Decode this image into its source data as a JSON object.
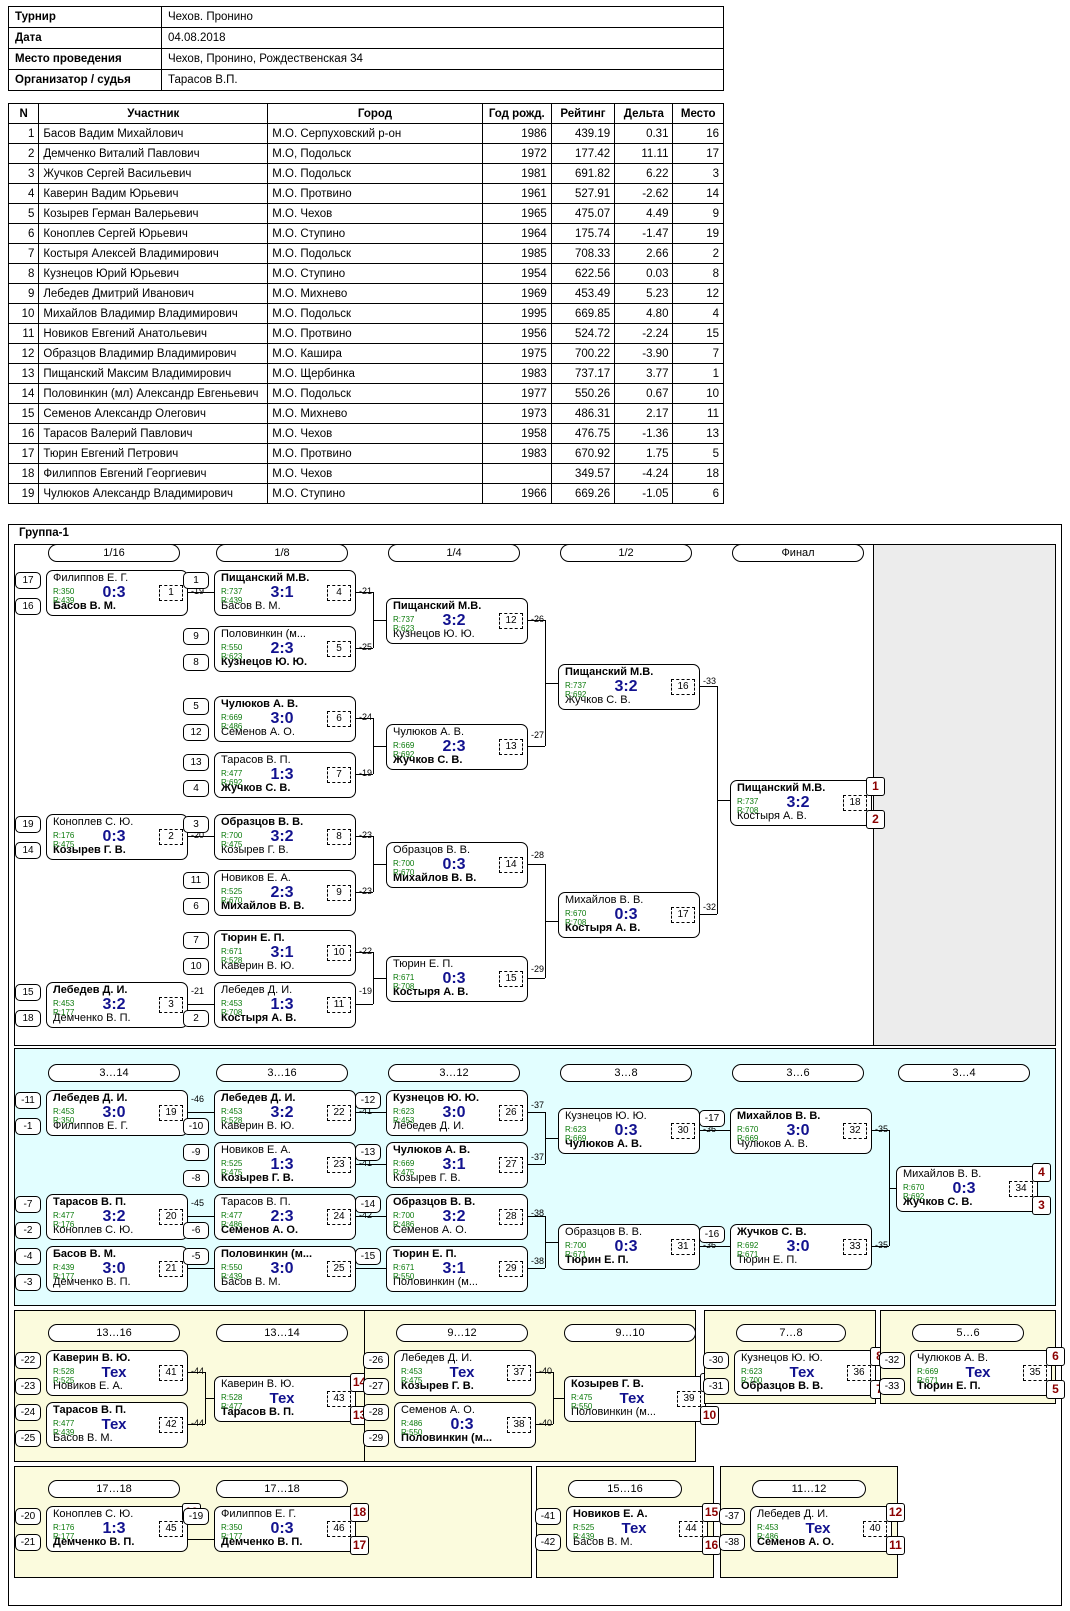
{
  "info": {
    "rows": [
      {
        "label": "Турнир",
        "value": "Чехов. Пронино"
      },
      {
        "label": "Дата",
        "value": "04.08.2018"
      },
      {
        "label": "Место проведения",
        "value": "Чехов, Пронино, Рождественская 34"
      },
      {
        "label": "Организатор / судья",
        "value": "Тарасов В.П."
      }
    ]
  },
  "participants": {
    "headers": [
      "N",
      "Участник",
      "Город",
      "Год рожд.",
      "Рейтинг",
      "Дельта",
      "Место"
    ],
    "rows": [
      {
        "n": "1",
        "name": "Басов Вадим Михайлович",
        "city": "М.О. Серпуховский р-он",
        "year": "1986",
        "rating": "439.19",
        "delta": "0.31",
        "place": "16"
      },
      {
        "n": "2",
        "name": "Демченко Виталий Павлович",
        "city": "М.О, Подольск",
        "year": "1972",
        "rating": "177.42",
        "delta": "11.11",
        "place": "17"
      },
      {
        "n": "3",
        "name": "Жучков Сергей Васильевич",
        "city": "М.О. Подольск",
        "year": "1981",
        "rating": "691.82",
        "delta": "6.22",
        "place": "3"
      },
      {
        "n": "4",
        "name": "Каверин Вадим Юрьевич",
        "city": "М.О. Протвино",
        "year": "1961",
        "rating": "527.91",
        "delta": "-2.62",
        "place": "14"
      },
      {
        "n": "5",
        "name": "Козырев Герман Валерьевич",
        "city": "М.О. Чехов",
        "year": "1965",
        "rating": "475.07",
        "delta": "4.49",
        "place": "9"
      },
      {
        "n": "6",
        "name": "Коноплев Сергей Юрьевич",
        "city": "М.О. Ступино",
        "year": "1964",
        "rating": "175.74",
        "delta": "-1.47",
        "place": "19"
      },
      {
        "n": "7",
        "name": "Костыря Алексей Владимирович",
        "city": "М.О. Подольск",
        "year": "1985",
        "rating": "708.33",
        "delta": "2.66",
        "place": "2"
      },
      {
        "n": "8",
        "name": "Кузнецов Юрий Юрьевич",
        "city": "М.О. Ступино",
        "year": "1954",
        "rating": "622.56",
        "delta": "0.03",
        "place": "8"
      },
      {
        "n": "9",
        "name": "Лебедев Дмитрий Иванович",
        "city": "М.О. Михнево",
        "year": "1969",
        "rating": "453.49",
        "delta": "5.23",
        "place": "12"
      },
      {
        "n": "10",
        "name": "Михайлов Владимир Владимирович",
        "city": "М.О. Подольск",
        "year": "1995",
        "rating": "669.85",
        "delta": "4.80",
        "place": "4"
      },
      {
        "n": "11",
        "name": "Новиков Евгений Анатольевич",
        "city": "М.О. Протвино",
        "year": "1956",
        "rating": "524.72",
        "delta": "-2.24",
        "place": "15"
      },
      {
        "n": "12",
        "name": "Образцов Владимир Владимирович",
        "city": "М.О. Кашира",
        "year": "1975",
        "rating": "700.22",
        "delta": "-3.90",
        "place": "7"
      },
      {
        "n": "13",
        "name": "Пищанский Максим Владимирович",
        "city": "М.О. Щербинка",
        "year": "1983",
        "rating": "737.17",
        "delta": "3.77",
        "place": "1"
      },
      {
        "n": "14",
        "name": "Половинкин (мл) Александр Евгеньевич",
        "city": "М.О. Подольск",
        "year": "1977",
        "rating": "550.26",
        "delta": "0.67",
        "place": "10"
      },
      {
        "n": "15",
        "name": "Семенов Александр Олегович",
        "city": "М.О. Михнево",
        "year": "1973",
        "rating": "486.31",
        "delta": "2.17",
        "place": "11"
      },
      {
        "n": "16",
        "name": "Тарасов Валерий Павлович",
        "city": "М.О. Чехов",
        "year": "1958",
        "rating": "476.75",
        "delta": "-1.36",
        "place": "13"
      },
      {
        "n": "17",
        "name": "Тюрин Евгений Петрович",
        "city": "М.О. Протвино",
        "year": "1983",
        "rating": "670.92",
        "delta": "1.75",
        "place": "5"
      },
      {
        "n": "18",
        "name": "Филиппов Евгений Георгиевич",
        "city": "М.О. Чехов",
        "year": "",
        "rating": "349.57",
        "delta": "-4.24",
        "place": "18"
      },
      {
        "n": "19",
        "name": "Чулюков Александр Владимирович",
        "city": "М.О. Ступино",
        "year": "1966",
        "rating": "669.26",
        "delta": "-1.05",
        "place": "6"
      }
    ]
  },
  "bracket": {
    "group_title": "Группа-1",
    "rounds_main": [
      "1/16",
      "1/8",
      "1/4",
      "1/2",
      "Финал"
    ],
    "rounds_cons": [
      "3…14",
      "3…16",
      "3…12",
      "3…8",
      "3…6",
      "3…4"
    ],
    "rounds_y1": [
      "13…16",
      "13…14"
    ],
    "rounds_y2": [
      "9…12",
      "9…10"
    ],
    "rounds_y3": [
      "7…8"
    ],
    "rounds_y4": [
      "5…6"
    ],
    "rounds_y5": [
      "17…18",
      "17…18"
    ],
    "rounds_y6": [
      "15…16"
    ],
    "rounds_y7": [
      "11…12"
    ],
    "matches": {
      "m1": {
        "s1": "17",
        "s2": "16",
        "p1": "Филиппов Е. Г.",
        "p2": "Басов В. М.",
        "r1": "R:350",
        "r2": "R:439",
        "sc": "0:3",
        "idx": "1",
        "w": 2
      },
      "m2": {
        "s1": "19",
        "s2": "14",
        "p1": "Коноплев С. Ю.",
        "p2": "Козырев Г. В.",
        "r1": "R:176",
        "r2": "R:475",
        "sc": "0:3",
        "idx": "2",
        "w": 2
      },
      "m3": {
        "s1": "15",
        "s2": "18",
        "p1": "Лебедев Д. И.",
        "p2": "Демченко В. П.",
        "r1": "R:453",
        "r2": "R:177",
        "sc": "3:2",
        "idx": "3",
        "w": 1
      },
      "m4": {
        "s1": "1",
        "s2": "",
        "p1": "Пищанский М.В.",
        "p2": "Басов В. М.",
        "r1": "R:737",
        "r2": "R:439",
        "sc": "3:1",
        "idx": "4",
        "w": 1
      },
      "m5": {
        "s1": "9",
        "s2": "8",
        "p1": "Половинкин (м...",
        "p2": "Кузнецов Ю. Ю.",
        "r1": "R:550",
        "r2": "R:623",
        "sc": "2:3",
        "idx": "5",
        "w": 2
      },
      "m6": {
        "s1": "5",
        "s2": "12",
        "p1": "Чулюков А. В.",
        "p2": "Семенов А. О.",
        "r1": "R:669",
        "r2": "R:486",
        "sc": "3:0",
        "idx": "6",
        "w": 1
      },
      "m7": {
        "s1": "13",
        "s2": "4",
        "p1": "Тарасов В. П.",
        "p2": "Жучков С. В.",
        "r1": "R:477",
        "r2": "R:692",
        "sc": "1:3",
        "idx": "7",
        "w": 2
      },
      "m8": {
        "s1": "3",
        "s2": "",
        "p1": "Образцов В. В.",
        "p2": "Козырев Г. В.",
        "r1": "R:700",
        "r2": "R:475",
        "sc": "3:2",
        "idx": "8",
        "w": 1
      },
      "m9": {
        "s1": "11",
        "s2": "6",
        "p1": "Новиков Е. А.",
        "p2": "Михайлов В. В.",
        "r1": "R:525",
        "r2": "R:670",
        "sc": "2:3",
        "idx": "9",
        "w": 2
      },
      "m10": {
        "s1": "7",
        "s2": "10",
        "p1": "Тюрин Е. П.",
        "p2": "Каверин В. Ю.",
        "r1": "R:671",
        "r2": "R:528",
        "sc": "3:1",
        "idx": "10",
        "w": 1
      },
      "m11": {
        "s1": "",
        "s2": "2",
        "p1": "Лебедев Д. И.",
        "p2": "Костыря А. В.",
        "r1": "R:453",
        "r2": "R:708",
        "sc": "1:3",
        "idx": "11",
        "w": 2
      },
      "m12": {
        "s1": "",
        "s2": "",
        "p1": "Пищанский М.В.",
        "p2": "Кузнецов Ю. Ю.",
        "r1": "R:737",
        "r2": "R:623",
        "sc": "3:2",
        "idx": "12",
        "w": 1
      },
      "m13": {
        "s1": "",
        "s2": "",
        "p1": "Чулюков А. В.",
        "p2": "Жучков С. В.",
        "r1": "R:669",
        "r2": "R:692",
        "sc": "2:3",
        "idx": "13",
        "w": 2
      },
      "m14": {
        "s1": "",
        "s2": "",
        "p1": "Образцов В. В.",
        "p2": "Михайлов В. В.",
        "r1": "R:700",
        "r2": "R:670",
        "sc": "0:3",
        "idx": "14",
        "w": 2
      },
      "m15": {
        "s1": "",
        "s2": "",
        "p1": "Тюрин Е. П.",
        "p2": "Костыря А. В.",
        "r1": "R:671",
        "r2": "R:708",
        "sc": "0:3",
        "idx": "15",
        "w": 2
      },
      "m16": {
        "s1": "",
        "s2": "",
        "p1": "Пищанский М.В.",
        "p2": "Жучков С. В.",
        "r1": "R:737",
        "r2": "R:692",
        "sc": "3:2",
        "idx": "16",
        "w": 1
      },
      "m17": {
        "s1": "",
        "s2": "",
        "p1": "Михайлов В. В.",
        "p2": "Костыря А. В.",
        "r1": "R:670",
        "r2": "R:708",
        "sc": "0:3",
        "idx": "17",
        "w": 2
      },
      "m18": {
        "s1": "",
        "s2": "",
        "p1": "Пищанский М.В.",
        "p2": "Костыря А. В.",
        "r1": "R:737",
        "r2": "R:708",
        "sc": "3:2",
        "idx": "18",
        "w": 1,
        "pl1": "1",
        "pl2": "2"
      },
      "m19": {
        "s1": "-11",
        "s2": "-1",
        "p1": "Лебедев Д. И.",
        "p2": "Филиппов Е. Г.",
        "r1": "R:453",
        "r2": "R:350",
        "sc": "3:0",
        "idx": "19",
        "w": 1
      },
      "m20": {
        "s1": "-7",
        "s2": "-2",
        "p1": "Тарасов В. П.",
        "p2": "Коноплев С. Ю.",
        "r1": "R:477",
        "r2": "R:176",
        "sc": "3:2",
        "idx": "20",
        "w": 1
      },
      "m21": {
        "s1": "-4",
        "s2": "-3",
        "p1": "Басов В. М.",
        "p2": "Демченко В. П.",
        "r1": "R:439",
        "r2": "R:177",
        "sc": "3:0",
        "idx": "21",
        "w": 1
      },
      "m22": {
        "s1": "",
        "s2": "-10",
        "p1": "Лебедев Д. И.",
        "p2": "Каверин В. Ю.",
        "r1": "R:453",
        "r2": "R:528",
        "sc": "3:2",
        "idx": "22",
        "w": 1
      },
      "m23": {
        "s1": "-9",
        "s2": "-8",
        "p1": "Новиков Е. А.",
        "p2": "Козырев Г. В.",
        "r1": "R:525",
        "r2": "R:475",
        "sc": "1:3",
        "idx": "23",
        "w": 2
      },
      "m24": {
        "s1": "",
        "s2": "-6",
        "p1": "Тарасов В. П.",
        "p2": "Семенов А. О.",
        "r1": "R:477",
        "r2": "R:486",
        "sc": "2:3",
        "idx": "24",
        "w": 2
      },
      "m25": {
        "s1": "-5",
        "s2": "",
        "p1": "Половинкин (м...",
        "p2": "Басов В. М.",
        "r1": "R:550",
        "r2": "R:439",
        "sc": "3:0",
        "idx": "25",
        "w": 1
      },
      "m26": {
        "s1": "-12",
        "s2": "",
        "p1": "Кузнецов Ю. Ю.",
        "p2": "Лебедев Д. И.",
        "r1": "R:623",
        "r2": "R:453",
        "sc": "3:0",
        "idx": "26",
        "w": 1
      },
      "m27": {
        "s1": "-13",
        "s2": "",
        "p1": "Чулюков А. В.",
        "p2": "Козырев Г. В.",
        "r1": "R:669",
        "r2": "R:475",
        "sc": "3:1",
        "idx": "27",
        "w": 1
      },
      "m28": {
        "s1": "-14",
        "s2": "",
        "p1": "Образцов В. В.",
        "p2": "Семенов А. О.",
        "r1": "R:700",
        "r2": "R:486",
        "sc": "3:2",
        "idx": "28",
        "w": 1
      },
      "m29": {
        "s1": "-15",
        "s2": "",
        "p1": "Тюрин Е. П.",
        "p2": "Половинкин (м...",
        "r1": "R:671",
        "r2": "R:550",
        "sc": "3:1",
        "idx": "29",
        "w": 1
      },
      "m30": {
        "s1": "",
        "s2": "",
        "p1": "Кузнецов Ю. Ю.",
        "p2": "Чулюков А. В.",
        "r1": "R:623",
        "r2": "R:669",
        "sc": "0:3",
        "idx": "30",
        "w": 2
      },
      "m31": {
        "s1": "",
        "s2": "",
        "p1": "Образцов В. В.",
        "p2": "Тюрин Е. П.",
        "r1": "R:700",
        "r2": "R:671",
        "sc": "0:3",
        "idx": "31",
        "w": 2
      },
      "m32": {
        "s1": "-17",
        "s2": "",
        "p1": "Михайлов В. В.",
        "p2": "Чулюков А. В.",
        "r1": "R:670",
        "r2": "R:669",
        "sc": "3:0",
        "idx": "32",
        "w": 1
      },
      "m33": {
        "s1": "-16",
        "s2": "",
        "p1": "Жучков С. В.",
        "p2": "Тюрин Е. П.",
        "r1": "R:692",
        "r2": "R:671",
        "sc": "3:0",
        "idx": "33",
        "w": 1
      },
      "m34": {
        "s1": "",
        "s2": "",
        "p1": "Михайлов В. В.",
        "p2": "Жучков С. В.",
        "r1": "R:670",
        "r2": "R:692",
        "sc": "0:3",
        "idx": "34",
        "w": 2,
        "pl1": "4",
        "pl2": "3"
      },
      "m41": {
        "s1": "-22",
        "s2": "-23",
        "p1": "Каверин В. Ю.",
        "p2": "Новиков Е. А.",
        "r1": "R:528",
        "r2": "R:525",
        "sc": "Тех",
        "idx": "41",
        "w": 1
      },
      "m42": {
        "s1": "-24",
        "s2": "-25",
        "p1": "Тарасов В. П.",
        "p2": "Басов В. М.",
        "r1": "R:477",
        "r2": "R:439",
        "sc": "Тех",
        "idx": "42",
        "w": 1
      },
      "m43": {
        "s1": "",
        "s2": "",
        "p1": "Каверин В. Ю.",
        "p2": "Тарасов В. П.",
        "r1": "R:528",
        "r2": "R:477",
        "sc": "Тех",
        "idx": "43",
        "w": 2,
        "pl1": "14",
        "pl2": "13"
      },
      "m37": {
        "s1": "-26",
        "s2": "-27",
        "p1": "Лебедев Д. И.",
        "p2": "Козырев Г. В.",
        "r1": "R:453",
        "r2": "R:475",
        "sc": "Тех",
        "idx": "37",
        "w": 2
      },
      "m38": {
        "s1": "-28",
        "s2": "-29",
        "p1": "Семенов А. О.",
        "p2": "Половинкин (м...",
        "r1": "R:486",
        "r2": "R:550",
        "sc": "0:3",
        "idx": "38",
        "w": 2
      },
      "m39": {
        "s1": "",
        "s2": "",
        "p1": "Козырев Г. В.",
        "p2": "Половинкин (м...",
        "r1": "R:475",
        "r2": "R:550",
        "sc": "Тех",
        "idx": "39",
        "w": 1,
        "pl1": "9",
        "pl2": "10"
      },
      "m36": {
        "s1": "-30",
        "s2": "-31",
        "p1": "Кузнецов Ю. Ю.",
        "p2": "Образцов В. В.",
        "r1": "R:623",
        "r2": "R:700",
        "sc": "Тех",
        "idx": "36",
        "w": 2,
        "pl1": "8",
        "pl2": "7"
      },
      "m35": {
        "s1": "-32",
        "s2": "-33",
        "p1": "Чулюков А. В.",
        "p2": "Тюрин Е. П.",
        "r1": "R:669",
        "r2": "R:671",
        "sc": "Тех",
        "idx": "35",
        "w": 2,
        "pl1": "6",
        "pl2": "5"
      },
      "m45": {
        "s1": "-20",
        "s2": "-21",
        "p1": "Коноплев С. Ю.",
        "p2": "Демченко В. П.",
        "r1": "R:176",
        "r2": "R:177",
        "sc": "1:3",
        "idx": "45",
        "w": 2,
        "pl1": "19"
      },
      "m46": {
        "s1": "-19",
        "s2": "",
        "p1": "Филиппов Е. Г.",
        "p2": "Демченко В. П.",
        "r1": "R:350",
        "r2": "R:177",
        "sc": "0:3",
        "idx": "46",
        "w": 2,
        "pl1": "18",
        "pl2": "17"
      },
      "m44": {
        "s1": "-41",
        "s2": "-42",
        "p1": "Новиков Е. А.",
        "p2": "Басов В. М.",
        "r1": "R:525",
        "r2": "R:439",
        "sc": "Тех",
        "idx": "44",
        "w": 1,
        "pl1": "15",
        "pl2": "16"
      },
      "m40": {
        "s1": "-37",
        "s2": "-38",
        "p1": "Лебедев Д. И.",
        "p2": "Семенов А. О.",
        "r1": "R:453",
        "r2": "R:486",
        "sc": "Тех",
        "idx": "40",
        "w": 2,
        "pl1": "12",
        "pl2": "11"
      }
    },
    "conn_labels": {
      "c19": "-19",
      "c21": "-21",
      "c20": "-20",
      "c19b": "-19",
      "c25": "-25",
      "c24": "-24",
      "c21b": "-21",
      "c23": "-23",
      "c23b": "-23",
      "c22": "-22",
      "c26": "-26",
      "c27": "-27",
      "c28": "-28",
      "c29": "-29",
      "c33": "-33",
      "c32": "-32",
      "c46": "-46",
      "c45": "-45",
      "c45b": "-45",
      "c41": "-41",
      "c41b": "-41",
      "c42": "-42",
      "c42b": "-42",
      "c10": "-10",
      "c9": "-9",
      "c8": "-8",
      "c6": "-6",
      "c5": "-5",
      "c37": "-37",
      "c37b": "-37",
      "c38": "-38",
      "c38b": "-38",
      "c36": "-36",
      "c36b": "-36",
      "c35": "-35",
      "c35b": "-35",
      "c44": "-44",
      "c44b": "-44",
      "c40": "-40",
      "c40b": "-40",
      "c19c": "-19"
    }
  }
}
